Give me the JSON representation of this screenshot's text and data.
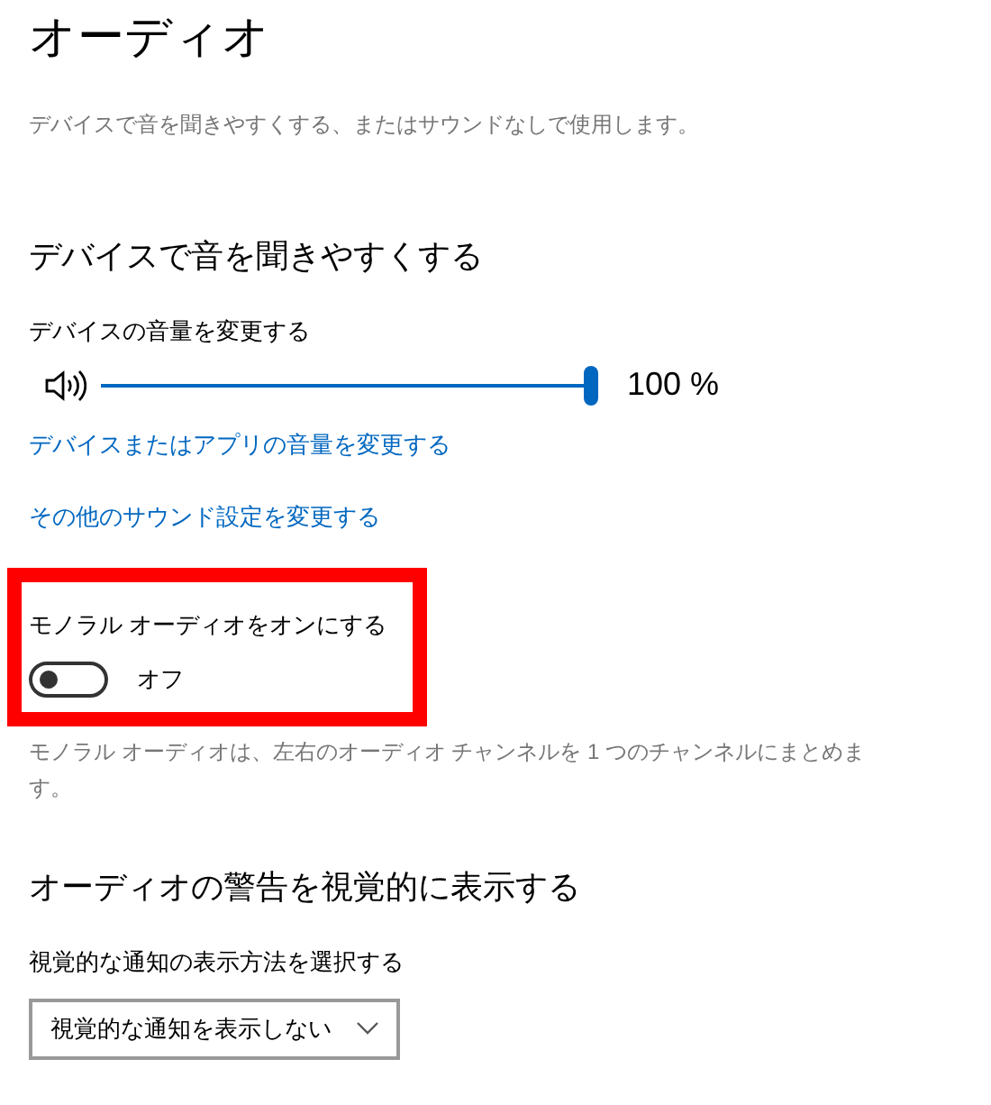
{
  "page_title": "オーディオ",
  "page_description": "デバイスで音を聞きやすくする、またはサウンドなしで使用します。",
  "sections": [
    {
      "heading": "デバイスで音を聞きやすくする",
      "volume": {
        "label": "デバイスの音量を変更する",
        "level": 1.0,
        "reading": "100 %"
      },
      "links": [
        "デバイスまたはアプリの音量を変更する",
        "その他のサウンド設定を変更する"
      ],
      "mono_audio": {
        "label": "モノラル オーディオをオンにする",
        "on": false,
        "state_text": "オフ",
        "highlighted": true,
        "description": "モノラル オーディオは、左右のオーディオ チャンネルを 1 つのチャンネルにまとめます。"
      }
    },
    {
      "heading": "オーディオの警告を視覚的に表示する",
      "dropdown": {
        "label": "視覚的な通知の表示方法を選択する",
        "value": "視覚的な通知を表示しない"
      }
    }
  ]
}
